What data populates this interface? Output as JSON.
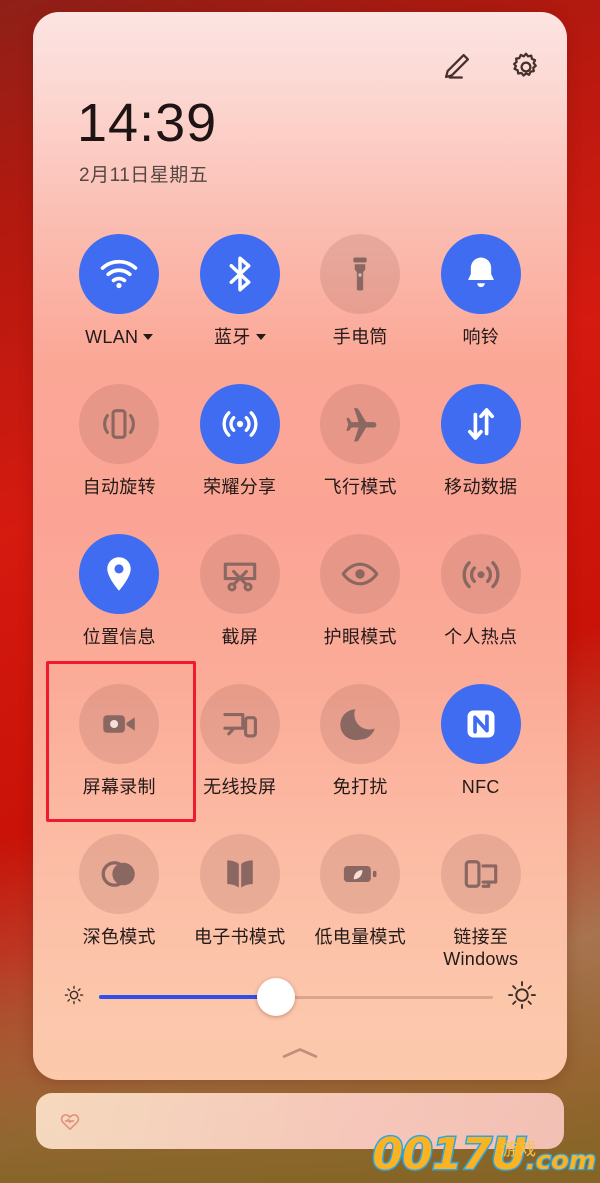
{
  "status": {
    "time": "14:39",
    "date": "2月11日星期五"
  },
  "header": {
    "edit_icon": "pencil-edit-icon",
    "settings_icon": "gear-icon"
  },
  "tiles": [
    {
      "label": "WLAN",
      "icon": "wifi-icon",
      "state": "on",
      "has_caret": true
    },
    {
      "label": "蓝牙",
      "icon": "bluetooth-icon",
      "state": "on",
      "has_caret": true
    },
    {
      "label": "手电筒",
      "icon": "flashlight-icon",
      "state": "off",
      "has_caret": false
    },
    {
      "label": "响铃",
      "icon": "bell-icon",
      "state": "on",
      "has_caret": false
    },
    {
      "label": "自动旋转",
      "icon": "auto-rotate-icon",
      "state": "off",
      "has_caret": false
    },
    {
      "label": "荣耀分享",
      "icon": "honor-share-icon",
      "state": "on",
      "has_caret": false
    },
    {
      "label": "飞行模式",
      "icon": "airplane-icon",
      "state": "off",
      "has_caret": false
    },
    {
      "label": "移动数据",
      "icon": "mobile-data-icon",
      "state": "on",
      "has_caret": false
    },
    {
      "label": "位置信息",
      "icon": "location-pin-icon",
      "state": "on",
      "has_caret": false
    },
    {
      "label": "截屏",
      "icon": "screenshot-icon",
      "state": "off",
      "has_caret": false
    },
    {
      "label": "护眼模式",
      "icon": "eye-comfort-icon",
      "state": "off",
      "has_caret": false
    },
    {
      "label": "个人热点",
      "icon": "hotspot-icon",
      "state": "off",
      "has_caret": false
    },
    {
      "label": "屏幕录制",
      "icon": "screen-record-icon",
      "state": "off",
      "has_caret": false
    },
    {
      "label": "无线投屏",
      "icon": "wireless-cast-icon",
      "state": "off",
      "has_caret": false
    },
    {
      "label": "免打扰",
      "icon": "moon-dnd-icon",
      "state": "off",
      "has_caret": false
    },
    {
      "label": "NFC",
      "icon": "nfc-icon",
      "state": "on",
      "has_caret": false
    },
    {
      "label": "深色模式",
      "icon": "dark-mode-icon",
      "state": "off",
      "has_caret": false
    },
    {
      "label": "电子书模式",
      "icon": "ebook-icon",
      "state": "off",
      "has_caret": false
    },
    {
      "label": "低电量模式",
      "icon": "battery-saver-icon",
      "state": "off",
      "has_caret": false
    },
    {
      "label": "链接至\nWindows",
      "icon": "link-to-windows-icon",
      "state": "off",
      "has_caret": false
    }
  ],
  "brightness": {
    "value_percent": 45,
    "low_icon": "sun-small-icon",
    "high_icon": "sun-large-icon"
  },
  "collapse": {
    "icon": "chevron-up-icon"
  },
  "notification": {
    "icon": "heart-health-icon"
  },
  "annotation": {
    "target_label": "屏幕录制",
    "color": "#ee1b2e"
  },
  "watermark": {
    "main": "0017U",
    "suffix": ".com",
    "cn": "游戏"
  },
  "colors": {
    "accent_on": "#3f6cf0",
    "slider_fill": "#2f4fe8",
    "panel_top": "#fce4e2",
    "panel_bottom": "#fcc9ad",
    "annotation": "#ee1b2e"
  }
}
